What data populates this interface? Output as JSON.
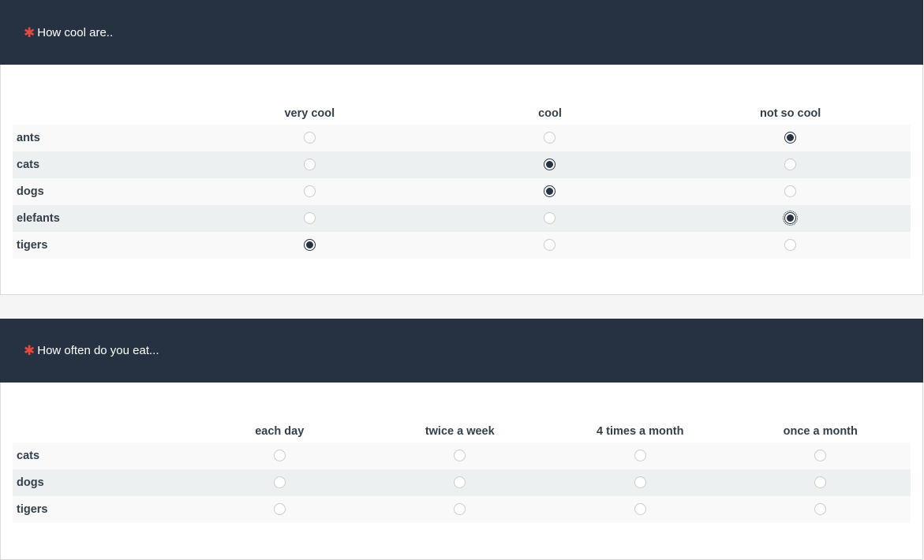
{
  "questions": [
    {
      "required_mark": "✱",
      "title": "How cool are..",
      "columns": [
        "very cool",
        "cool",
        "not so cool"
      ],
      "rows": [
        {
          "label": "ants",
          "selected": 2
        },
        {
          "label": "cats",
          "selected": 1
        },
        {
          "label": "dogs",
          "selected": 1
        },
        {
          "label": "elefants",
          "selected": 2,
          "focused": 2
        },
        {
          "label": "tigers",
          "selected": 0
        }
      ]
    },
    {
      "required_mark": "✱",
      "title": "How often do you eat...",
      "columns": [
        "each day",
        "twice a week",
        "4 times a month",
        "once a month"
      ],
      "rows": [
        {
          "label": "cats",
          "selected": null
        },
        {
          "label": "dogs",
          "selected": null
        },
        {
          "label": "tigers",
          "selected": null
        }
      ]
    }
  ],
  "colors": {
    "header_bg": "#263241",
    "required_mark": "#e8493e",
    "selected_radio": "#263241"
  }
}
